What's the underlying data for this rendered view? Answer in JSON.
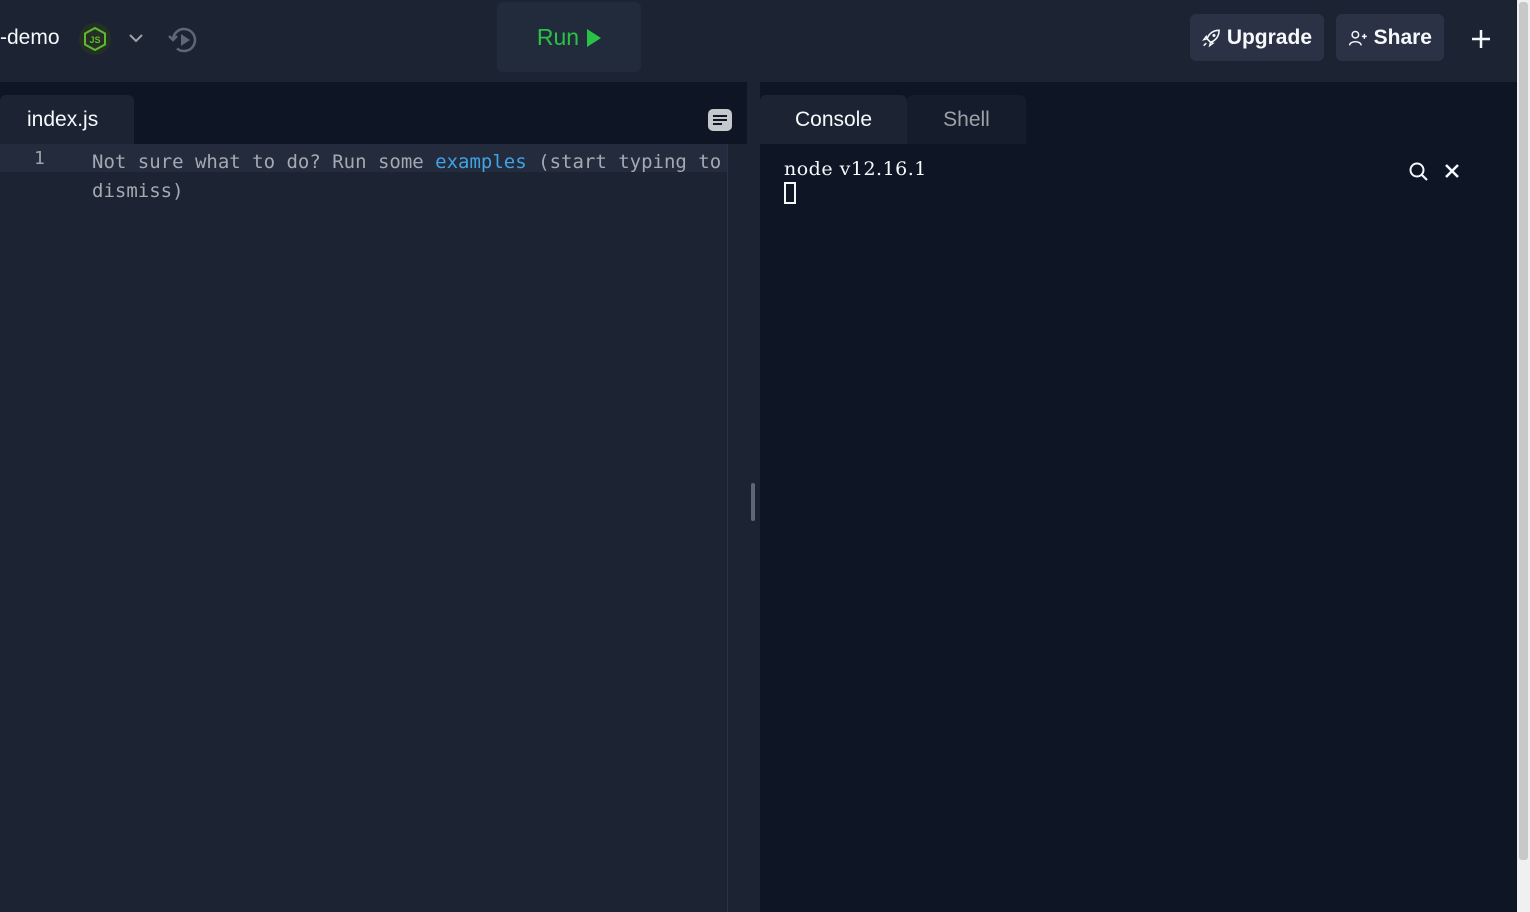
{
  "header": {
    "project_name": "-demo",
    "language_badge": "JS",
    "icons": {
      "language": "nodejs-icon",
      "dropdown": "chevron-down-icon",
      "history": "history-icon",
      "upgrade": "rocket-icon",
      "share": "add-user-icon",
      "new": "plus-icon"
    },
    "run_label": "Run",
    "upgrade_label": "Upgrade",
    "share_label": "Share"
  },
  "editor": {
    "tab_label": "index.js",
    "line_number": "1",
    "placeholder_before": "Not sure what to do? Run some ",
    "placeholder_link": "examples",
    "placeholder_after": " (start typing to dismiss)",
    "format_icon": "format-icon"
  },
  "console": {
    "tabs": [
      {
        "label": "Console",
        "active": true
      },
      {
        "label": "Shell",
        "active": false
      }
    ],
    "output_line": "node v12.16.1",
    "icons": {
      "search": "search-icon",
      "clear": "close-icon"
    }
  },
  "colors": {
    "run_green": "#29c244",
    "link_blue": "#3fa3e4",
    "background": "#1c2333",
    "console_bg": "#0e1525"
  }
}
